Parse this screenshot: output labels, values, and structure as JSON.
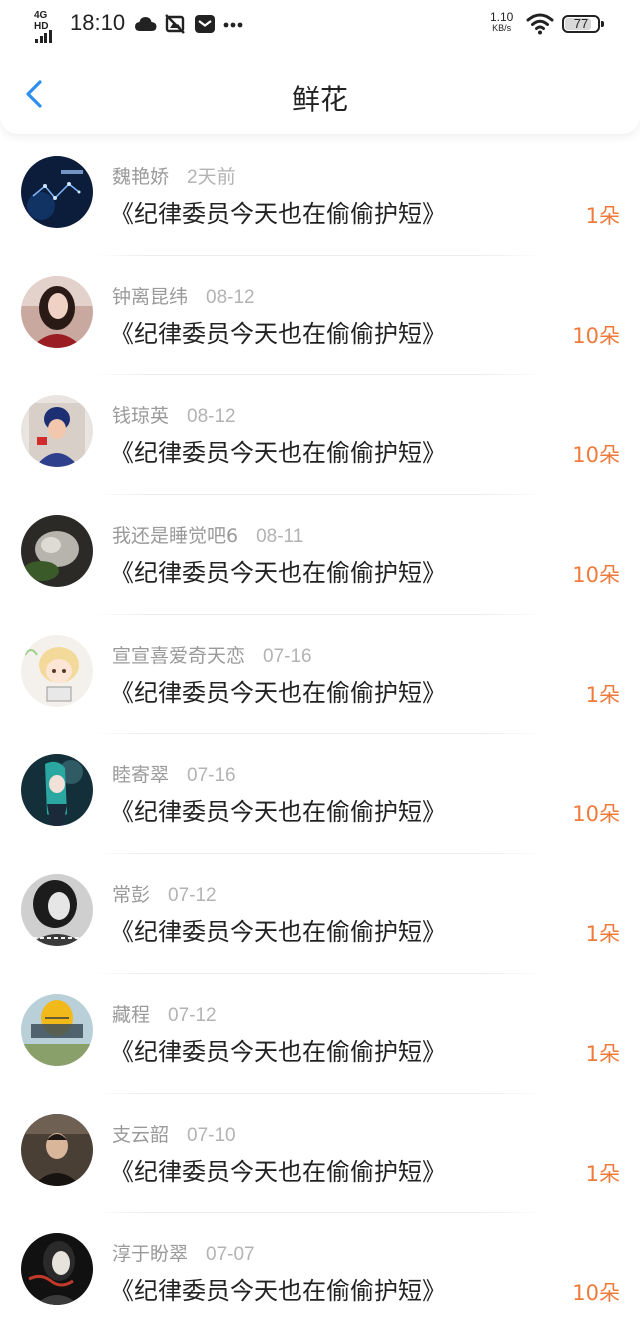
{
  "status_bar": {
    "network": "4G HD",
    "time": "18:10",
    "speed_value": "1.10",
    "speed_unit": "KB/s",
    "battery": "77",
    "battery_level": 0.77
  },
  "header": {
    "title": "鲜花"
  },
  "colors": {
    "accent": "#2d8ff0",
    "flower_count": "#f07a3a",
    "username": "#9a9a9a"
  },
  "items": [
    {
      "user": "魏艳娇",
      "time": "2天前",
      "title": "《纪律委员今天也在偷偷护短》",
      "count": "1朵"
    },
    {
      "user": "钟离昆纬",
      "time": "08-12",
      "title": "《纪律委员今天也在偷偷护短》",
      "count": "10朵"
    },
    {
      "user": "钱琼英",
      "time": "08-12",
      "title": "《纪律委员今天也在偷偷护短》",
      "count": "10朵"
    },
    {
      "user": "我还是睡觉吧6",
      "time": "08-11",
      "title": "《纪律委员今天也在偷偷护短》",
      "count": "10朵"
    },
    {
      "user": "宣宣喜爱奇天恋",
      "time": "07-16",
      "title": "《纪律委员今天也在偷偷护短》",
      "count": "1朵"
    },
    {
      "user": "睦寄翠",
      "time": "07-16",
      "title": "《纪律委员今天也在偷偷护短》",
      "count": "10朵"
    },
    {
      "user": "常彭",
      "time": "07-12",
      "title": "《纪律委员今天也在偷偷护短》",
      "count": "1朵"
    },
    {
      "user": "藏程",
      "time": "07-12",
      "title": "《纪律委员今天也在偷偷护短》",
      "count": "1朵"
    },
    {
      "user": "支云韶",
      "time": "07-10",
      "title": "《纪律委员今天也在偷偷护短》",
      "count": "1朵"
    },
    {
      "user": "淳于盼翠",
      "time": "07-07",
      "title": "《纪律委员今天也在偷偷护短》",
      "count": "10朵"
    }
  ]
}
